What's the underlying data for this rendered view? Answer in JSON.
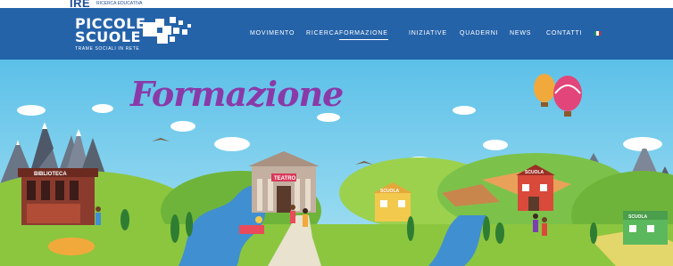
{
  "brand": {
    "top_logo": "IRE",
    "top_sub": "RICERCA EDUCATIVA",
    "name_line1": "PICCOLE",
    "name_line2": "SCUOLE",
    "tagline": "TRAME SOCIALI IN RETE"
  },
  "nav": {
    "items": [
      {
        "label": "MOVIMENTO"
      },
      {
        "label": "RICERCA"
      },
      {
        "label": "FORMAZIONE"
      },
      {
        "label": "INIZIATIVE"
      },
      {
        "label": "QUADERNI"
      },
      {
        "label": "NEWS"
      },
      {
        "label": "CONTATTI"
      }
    ],
    "active_index": 2,
    "language_flag": "italian-flag-icon"
  },
  "hero": {
    "title": "Formazione",
    "signs": {
      "biblioteca": "BIBLIOTECA",
      "teatro": "TEATRO",
      "scuola_a": "SCUOLA",
      "scuola_b": "SCUOLA",
      "scuola_c": "SCUOLA"
    }
  },
  "colors": {
    "header_bg": "#2563a9",
    "sky": "#67c2e8",
    "title": "#8a3aa8",
    "grass": "#7cc24a",
    "water": "#3f8fd1"
  }
}
